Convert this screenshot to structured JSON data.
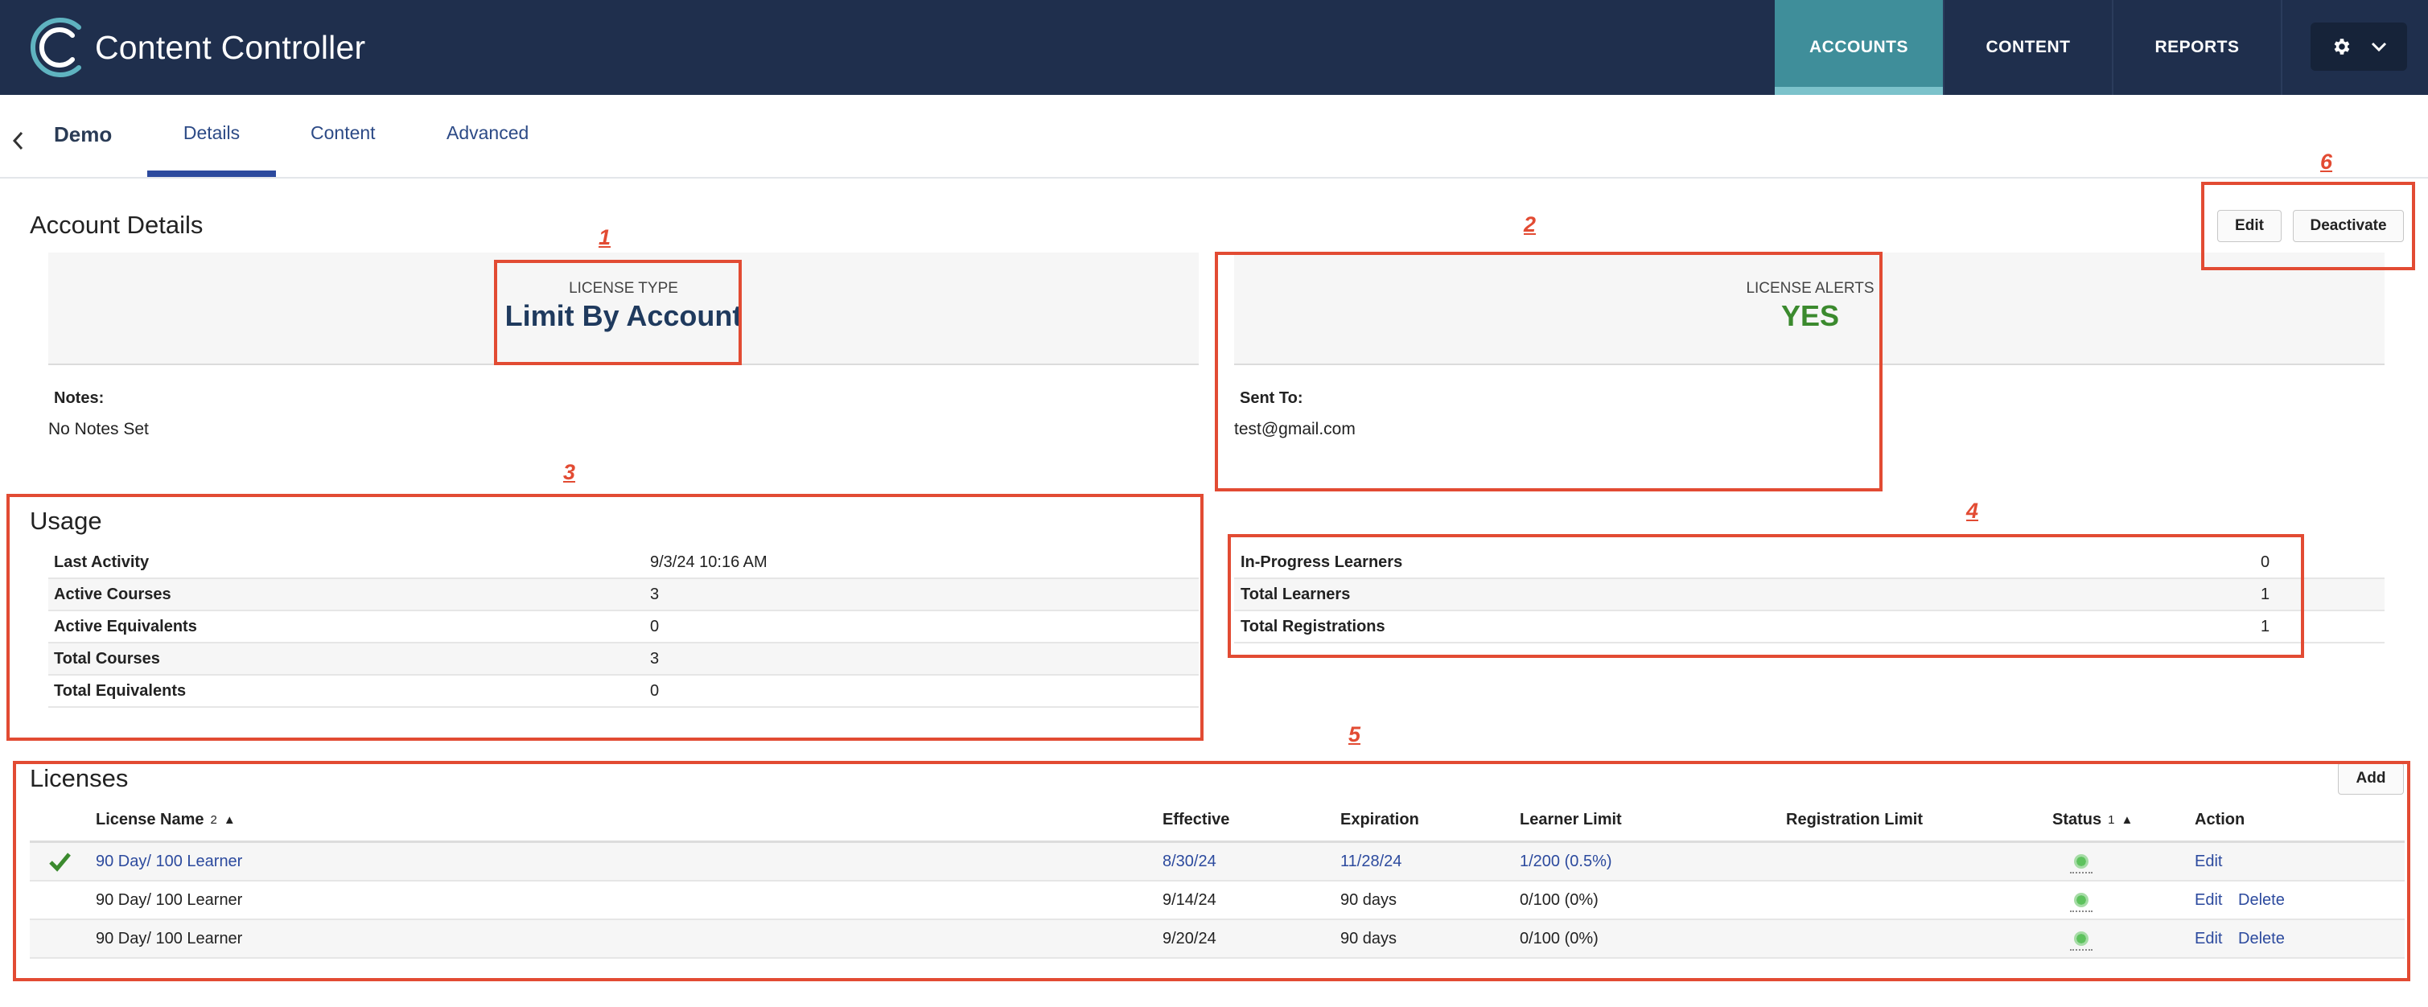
{
  "app": {
    "title": "Content Controller"
  },
  "nav": {
    "accounts": "ACCOUNTS",
    "content": "CONTENT",
    "reports": "REPORTS"
  },
  "subnav": {
    "account_name": "Demo",
    "tabs": {
      "details": "Details",
      "content": "Content",
      "advanced": "Advanced"
    }
  },
  "account_details": {
    "heading": "Account Details",
    "edit_label": "Edit",
    "deactivate_label": "Deactivate",
    "license_type": {
      "label": "LICENSE TYPE",
      "value": "Limit By Account"
    },
    "license_alerts": {
      "label": "LICENSE ALERTS",
      "value": "YES"
    },
    "notes": {
      "label": "Notes:",
      "value": "No Notes Set"
    },
    "sent_to": {
      "label": "Sent To:",
      "value": "test@gmail.com"
    }
  },
  "usage": {
    "heading": "Usage",
    "rows": [
      {
        "label": "Last Activity",
        "value": "9/3/24 10:16 AM"
      },
      {
        "label": "Active Courses",
        "value": "3"
      },
      {
        "label": "Active Equivalents",
        "value": "0"
      },
      {
        "label": "Total Courses",
        "value": "3"
      },
      {
        "label": "Total Equivalents",
        "value": "0"
      }
    ]
  },
  "learners": {
    "rows": [
      {
        "label": "In-Progress Learners",
        "value": "0"
      },
      {
        "label": "Total Learners",
        "value": "1"
      },
      {
        "label": "Total Registrations",
        "value": "1"
      }
    ]
  },
  "licenses": {
    "heading": "Licenses",
    "add_label": "Add",
    "columns": {
      "name": "License Name",
      "name_sort": "2",
      "effective": "Effective",
      "expiration": "Expiration",
      "learner_limit": "Learner Limit",
      "registration_limit": "Registration Limit",
      "status": "Status",
      "status_sort": "1",
      "action": "Action"
    },
    "rows": [
      {
        "name": "90 Day/ 100 Learner",
        "effective": "8/30/24",
        "expiration": "11/28/24",
        "learner_limit": "1/200 (0.5%)",
        "registration_limit": "",
        "edit": "Edit",
        "delete": ""
      },
      {
        "name": "90 Day/ 100 Learner",
        "effective": "9/14/24",
        "expiration": "90 days",
        "learner_limit": "0/100 (0%)",
        "registration_limit": "",
        "edit": "Edit",
        "delete": "Delete"
      },
      {
        "name": "90 Day/ 100 Learner",
        "effective": "9/20/24",
        "expiration": "90 days",
        "learner_limit": "0/100 (0%)",
        "registration_limit": "",
        "edit": "Edit",
        "delete": "Delete"
      }
    ]
  },
  "annotations": [
    "1",
    "2",
    "3",
    "4",
    "5",
    "6"
  ],
  "colors": {
    "topbar": "#1f2f4d",
    "active_nav": "#3f8e9a",
    "link": "#2c4a9e",
    "alert_yes": "#3b8a2e",
    "annotation": "#e24b33"
  }
}
